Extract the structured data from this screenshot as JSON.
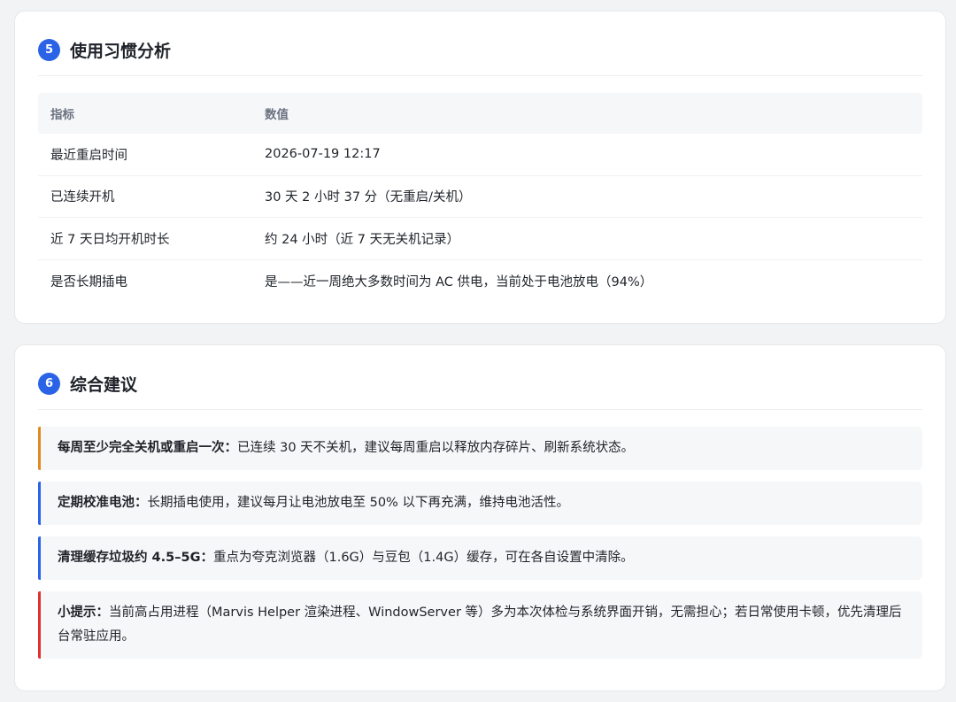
{
  "habits": {
    "number": "5",
    "title": "使用习惯分析",
    "header": {
      "metric": "指标",
      "value": "数值"
    },
    "rows": [
      {
        "metric": "最近重启时间",
        "value": "2026-07-19 12:17"
      },
      {
        "metric": "已连续开机",
        "value": "30 天 2 小时 37 分（无重启/关机）"
      },
      {
        "metric": "近 7 天日均开机时长",
        "value": "约 24 小时（近 7 天无关机记录）"
      },
      {
        "metric": "是否长期插电",
        "value": "是——近一周绝大多数时间为 AC 供电，当前处于电池放电（94%）"
      }
    ]
  },
  "advice": {
    "number": "6",
    "title": "综合建议",
    "items": [
      {
        "label": "每周至少完全关机或重启一次：",
        "text": "已连续 30 天不关机，建议每周重启以释放内存碎片、刷新系统状态。",
        "accent": "#e08a1e"
      },
      {
        "label": "定期校准电池：",
        "text": "长期插电使用，建议每月让电池放电至 50% 以下再充满，维持电池活性。",
        "accent": "#2b63e6"
      },
      {
        "label": "清理缓存垃圾约 4.5–5G：",
        "text": "重点为夸克浏览器（1.6G）与豆包（1.4G）缓存，可在各自设置中清除。",
        "accent": "#2b63e6"
      },
      {
        "label": "小提示：",
        "text": "当前高占用进程（Marvis Helper 渲染进程、WindowServer 等）多为本次体检与系统界面开销，无需担心；若日常使用卡顿，优先清理后台常驻应用。",
        "accent": "#e03131"
      }
    ]
  }
}
